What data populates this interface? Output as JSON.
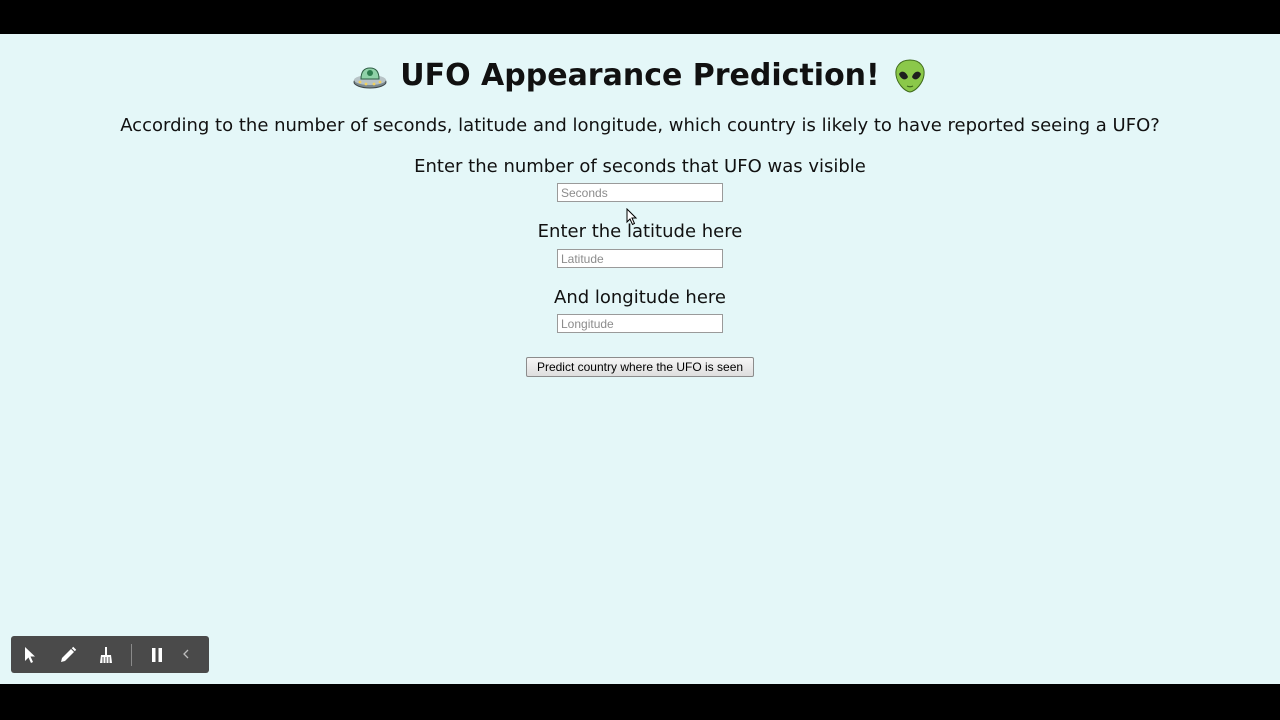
{
  "header": {
    "title": "UFO Appearance Prediction!",
    "left_icon": "ufo-icon",
    "right_icon": "alien-icon"
  },
  "subtitle": "According to the number of seconds, latitude and longitude, which country is likely to have reported seeing a UFO?",
  "form": {
    "seconds": {
      "label": "Enter the number of seconds that UFO was visible",
      "placeholder": "Seconds",
      "value": ""
    },
    "latitude": {
      "label": "Enter the latitude here",
      "placeholder": "Latitude",
      "value": ""
    },
    "longitude": {
      "label": "And longitude here",
      "placeholder": "Longitude",
      "value": ""
    },
    "submit_label": "Predict country where the UFO is seen"
  },
  "toolbar": {
    "items": [
      "pointer-icon",
      "pencil-icon",
      "broom-icon",
      "pause-icon",
      "collapse-chevron-icon"
    ]
  },
  "colors": {
    "page_background": "#e4f7f8",
    "letterbox": "#000000",
    "toolbar_background": "#4a4a4a"
  }
}
